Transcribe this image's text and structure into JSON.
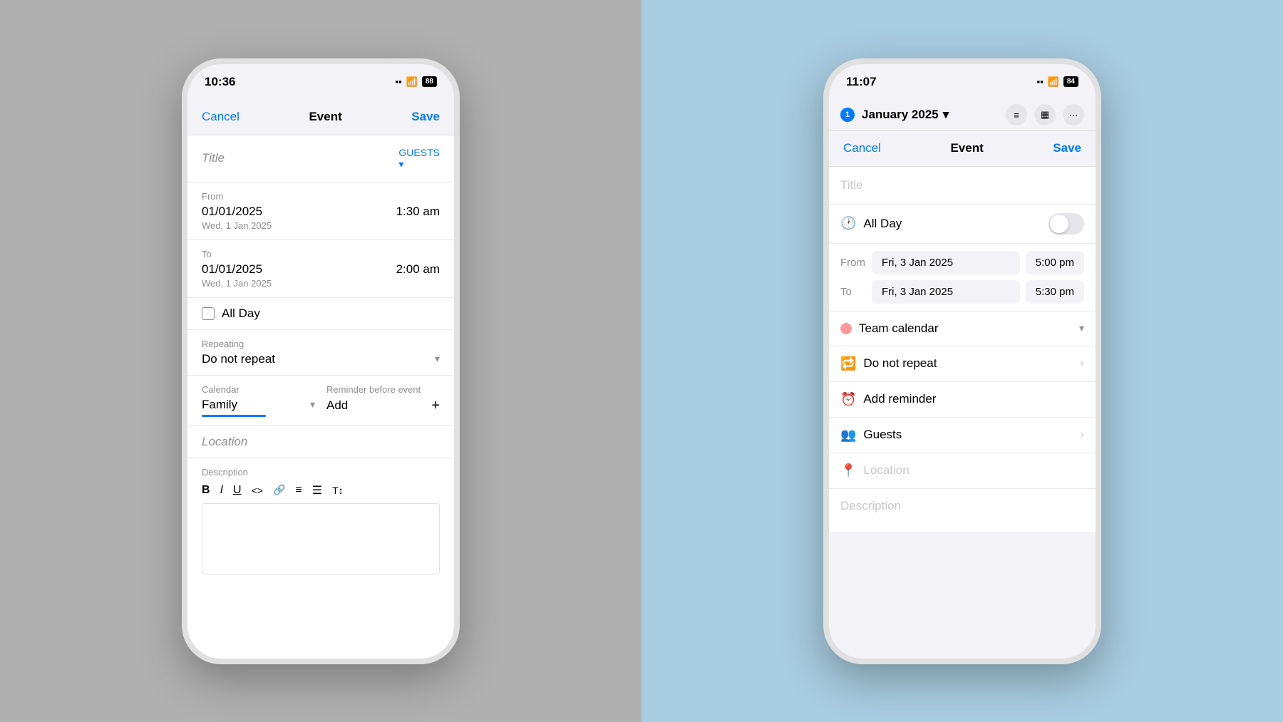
{
  "left_phone": {
    "status_bar": {
      "time": "10:36",
      "signal": "▪▪▪",
      "wifi": "wifi",
      "battery": "88"
    },
    "nav": {
      "cancel": "Cancel",
      "title": "Event",
      "save": "Save"
    },
    "form": {
      "title_placeholder": "Title",
      "guests_btn": "GUESTS ▾",
      "from_label": "From",
      "from_date": "01/01/2025",
      "from_time": "1:30 am",
      "from_day": "Wed, 1 Jan 2025",
      "to_label": "To",
      "to_date": "01/01/2025",
      "to_time": "2:00 am",
      "to_day": "Wed, 1 Jan 2025",
      "allday_label": "All Day",
      "repeating_label": "Repeating",
      "repeating_value": "Do not repeat",
      "calendar_label": "Calendar",
      "calendar_value": "Family",
      "reminder_label": "Reminder before event",
      "reminder_value": "Add",
      "location_label": "Location",
      "description_label": "Description",
      "toolbar": [
        "B",
        "I",
        "U",
        "<>",
        "🔗",
        "≡",
        "☰",
        "T↕"
      ]
    }
  },
  "right_phone": {
    "status_bar": {
      "time": "11:07",
      "signal": "▪▪▪",
      "wifi": "wifi",
      "battery": "84"
    },
    "calendar_header": {
      "badge": "1",
      "month": "January 2025",
      "chevron": "▾"
    },
    "nav": {
      "cancel": "Cancel",
      "title": "Event",
      "save": "Save"
    },
    "form": {
      "title_placeholder": "Title",
      "allday_label": "All Day",
      "from_label": "From",
      "from_date": "Fri, 3 Jan 2025",
      "from_time": "5:00 pm",
      "to_label": "To",
      "to_date": "Fri, 3 Jan 2025",
      "to_time": "5:30 pm",
      "calendar_label": "Team calendar",
      "repeat_label": "Do not repeat",
      "reminder_label": "Add reminder",
      "guests_label": "Guests",
      "location_placeholder": "Location",
      "description_placeholder": "Description"
    }
  }
}
